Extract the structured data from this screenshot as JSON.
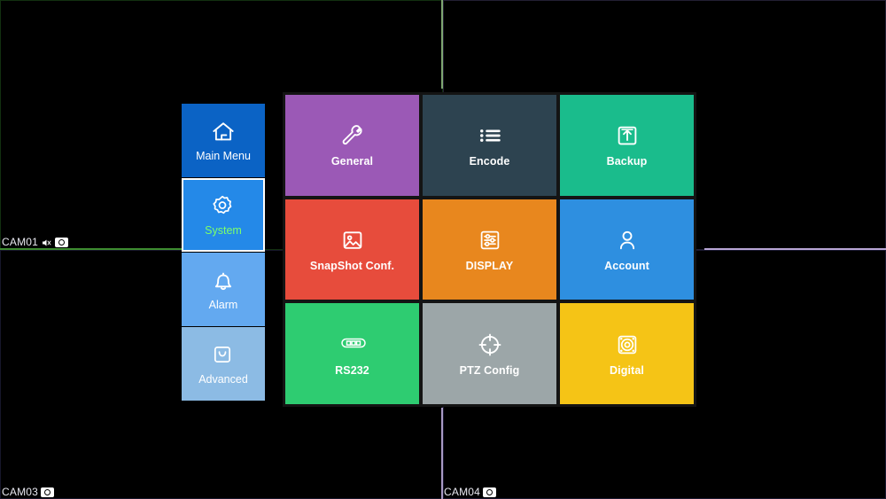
{
  "wall": {
    "background_color": "#000000",
    "dividers": [
      {
        "name": "vertical-top",
        "color": "#7fa772"
      },
      {
        "name": "horizontal-left",
        "color": "#3e8c30"
      },
      {
        "name": "horizontal-right",
        "color": "#b9a6d6"
      },
      {
        "name": "vertical-bottom",
        "color": "#a99ac4"
      }
    ],
    "cameras": [
      {
        "id": "cam01",
        "label": "CAM01",
        "icons": [
          "mute-icon",
          "camera-icon"
        ]
      },
      {
        "id": "cam03",
        "label": "CAM03",
        "icons": [
          "camera-icon"
        ]
      },
      {
        "id": "cam04",
        "label": "CAM04",
        "icons": [
          "camera-icon"
        ]
      }
    ]
  },
  "sidebar": {
    "items": [
      {
        "label": "Main Menu",
        "icon": "home-icon",
        "color": "#0b63c5",
        "selected": false
      },
      {
        "label": "System",
        "icon": "gear-icon",
        "color": "#2489e8",
        "selected": true
      },
      {
        "label": "Alarm",
        "icon": "bell-icon",
        "color": "#63a9f0",
        "selected": false
      },
      {
        "label": "Advanced",
        "icon": "toolbox-icon",
        "color": "#8cbbe4",
        "selected": false
      }
    ],
    "selected_label_color": "#7dff6b"
  },
  "grid": {
    "panel_color": "#141414",
    "tiles": [
      {
        "label": "General",
        "icon": "wrench-icon",
        "color": "#9b59b6"
      },
      {
        "label": "Encode",
        "icon": "list-icon",
        "color": "#2d4350"
      },
      {
        "label": "Backup",
        "icon": "upload-icon",
        "color": "#1abc8c"
      },
      {
        "label": "SnapShot Conf.",
        "icon": "image-icon",
        "color": "#e74c3c"
      },
      {
        "label": "DISPLAY",
        "icon": "sliders-icon",
        "color": "#e8871e"
      },
      {
        "label": "Account",
        "icon": "user-icon",
        "color": "#2e8fe0"
      },
      {
        "label": "RS232",
        "icon": "serial-icon",
        "color": "#2ecc71"
      },
      {
        "label": "PTZ Config",
        "icon": "crosshair-icon",
        "color": "#9ca6a8"
      },
      {
        "label": "Digital",
        "icon": "speaker-icon",
        "color": "#f5c416"
      }
    ]
  }
}
